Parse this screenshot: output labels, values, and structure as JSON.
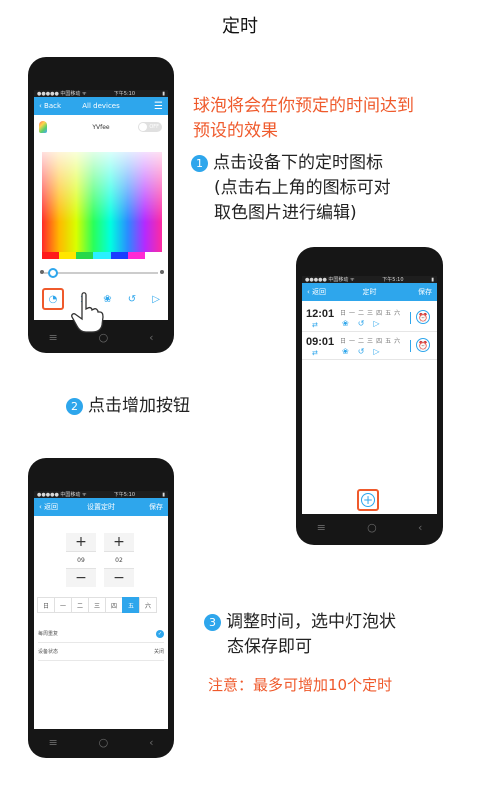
{
  "page": {
    "title": "定时"
  },
  "intro": {
    "line1": "球泡将会在你预定的时间达到",
    "line2": "预设的效果"
  },
  "step1": {
    "num": "1",
    "line1": "点击设备下的定时图标",
    "line2": "(点击右上角的图标可对",
    "line3": "取色图片进行编辑)"
  },
  "step2": {
    "num": "2",
    "text": "点击增加按钮"
  },
  "step3": {
    "num": "3",
    "line1": "调整时间，选中灯泡状",
    "line2": "态保存即可"
  },
  "note": "注意：最多可增加10个定时",
  "status_bar": {
    "carrier": "●●●●● 中国移动 ᯤ",
    "time": "下午5:10"
  },
  "phone1": {
    "back": "Back",
    "title": "All devices",
    "device_name": "YVfee",
    "toggle": "OFF",
    "swatches": [
      "#ff1a1a",
      "#ffe600",
      "#27d84a",
      "#2af0ff",
      "#1a3cff",
      "#ff2ad4",
      "#ffffff"
    ]
  },
  "phone2": {
    "back": "返回",
    "title": "定时",
    "save": "保存",
    "timers": [
      {
        "time": "12:01",
        "days": [
          "日",
          "一",
          "二",
          "三",
          "四",
          "五",
          "六"
        ]
      },
      {
        "time": "09:01",
        "days": [
          "日",
          "一",
          "二",
          "三",
          "四",
          "五",
          "六"
        ]
      }
    ]
  },
  "phone3": {
    "back": "返回",
    "title": "设置定时",
    "save": "保存",
    "hour": "09",
    "minute": "02",
    "days": [
      "日",
      "一",
      "二",
      "三",
      "四",
      "五",
      "六"
    ],
    "selected_day": "五",
    "repeat_label": "每周重复",
    "state_label": "设备状态",
    "state_value": "关闭"
  },
  "nav_keys": {
    "menu": "≡",
    "home": "○",
    "back": "‹"
  },
  "accent_color": "#2ea6ec",
  "highlight_color": "#ef5a2c"
}
